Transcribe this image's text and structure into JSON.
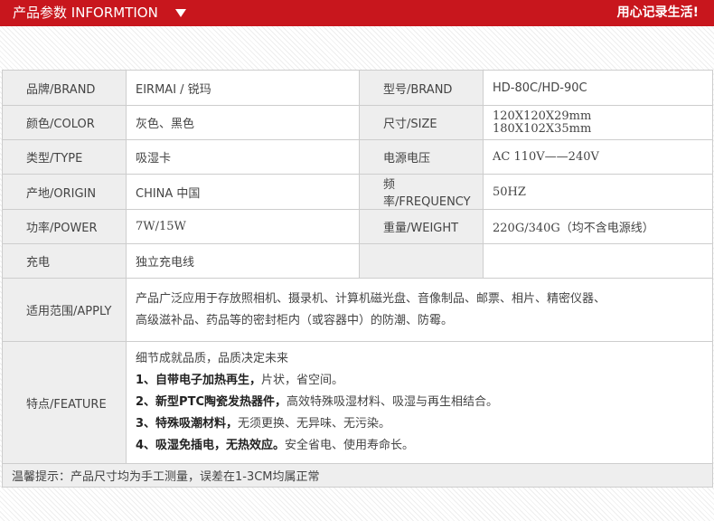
{
  "header": {
    "title": "产品参数 INFORMTION",
    "slogan": "用心记录生活!"
  },
  "spec": {
    "brand_label": "品牌/BRAND",
    "brand_value": "EIRMAI / 锐玛",
    "model_label": "型号/BRAND",
    "model_value": "HD-80C/HD-90C",
    "color_label": "颜色/COLOR",
    "color_value": "灰色、黑色",
    "size_label": "尺寸/SIZE",
    "size_value_1": "120X120X29mm",
    "size_value_2": "180X102X35mm",
    "type_label": "类型/TYPE",
    "type_value": "吸湿卡",
    "voltage_label": "电源电压",
    "voltage_value": "AC 110V——240V",
    "origin_label": "产地/ORIGIN",
    "origin_value": "CHINA 中国",
    "frequency_label": "频率/FREQUENCY",
    "frequency_value": "50HZ",
    "power_label": "功率/POWER",
    "power_value": "7W/15W",
    "weight_label": "重量/WEIGHT",
    "weight_value": "220G/340G（均不含电源线）",
    "charge_label": "充电",
    "charge_value": "独立充电线",
    "apply_label": "适用范围/APPLY",
    "apply_line_1": "产品广泛应用于存放照相机、摄录机、计算机磁光盘、音像制品、邮票、相片、精密仪器、",
    "apply_line_2": "高级滋补品、药品等的密封柜内（或容器中）的防潮、防霉。",
    "feature_label": "特点/FEATURE",
    "features": {
      "intro": "细节成就品质，品质决定未来",
      "f1_bold": "1、自带电子加热再生，",
      "f1_rest": "片状，省空间。",
      "f2_bold": "2、新型PTC陶瓷发热器件，",
      "f2_rest": "高效特殊吸湿材料、吸湿与再生相结合。",
      "f3_bold": "3、特殊吸潮材料，",
      "f3_rest": "无须更换、无异味、无污染。",
      "f4_bold": "4、吸湿免插电，无热效应。",
      "f4_rest": "安全省电、使用寿命长。"
    },
    "note": "温馨提示：产品尺寸均为手工测量，误差在1-3CM均属正常"
  }
}
